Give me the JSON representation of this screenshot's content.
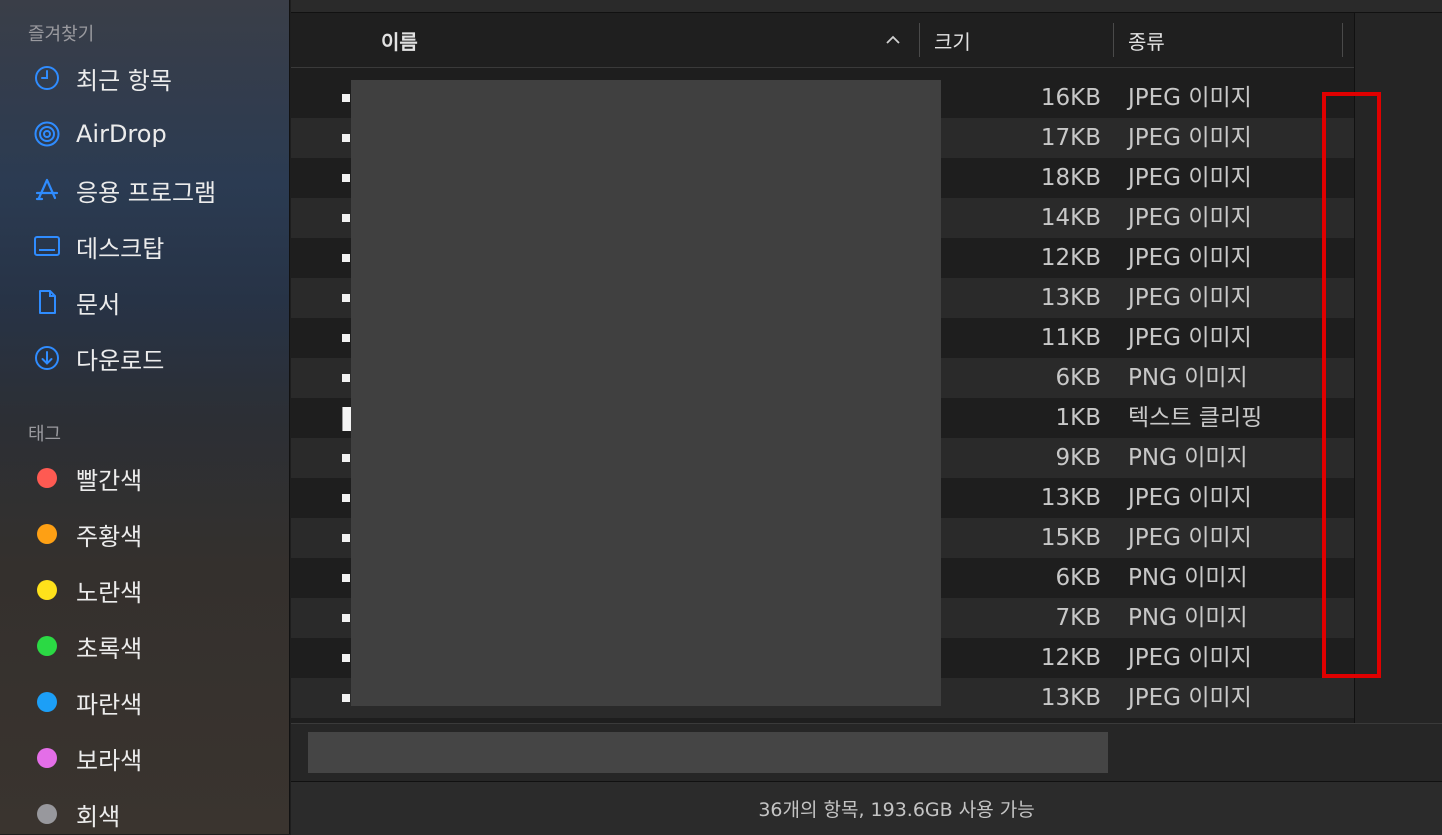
{
  "sidebar": {
    "favorites_title": "즐겨찾기",
    "favorites": [
      {
        "label": "최근 항목",
        "icon": "clock-icon"
      },
      {
        "label": "AirDrop",
        "icon": "airdrop-icon"
      },
      {
        "label": "응용 프로그램",
        "icon": "applications-icon"
      },
      {
        "label": "데스크탑",
        "icon": "desktop-icon"
      },
      {
        "label": "문서",
        "icon": "document-icon"
      },
      {
        "label": "다운로드",
        "icon": "download-icon"
      }
    ],
    "tags_title": "태그",
    "tags": [
      {
        "label": "빨간색",
        "color": "#fe5a52"
      },
      {
        "label": "주황색",
        "color": "#fea014"
      },
      {
        "label": "노란색",
        "color": "#fee11b"
      },
      {
        "label": "초록색",
        "color": "#2bd944"
      },
      {
        "label": "파란색",
        "color": "#1c9ff7"
      },
      {
        "label": "보라색",
        "color": "#e46ee8"
      },
      {
        "label": "회색",
        "color": "#98989d"
      }
    ]
  },
  "columns": {
    "name": "이름",
    "size": "크기",
    "kind": "종류"
  },
  "files": [
    {
      "size": "16KB",
      "kind": "JPEG 이미지"
    },
    {
      "size": "17KB",
      "kind": "JPEG 이미지"
    },
    {
      "size": "18KB",
      "kind": "JPEG 이미지"
    },
    {
      "size": "14KB",
      "kind": "JPEG 이미지"
    },
    {
      "size": "12KB",
      "kind": "JPEG 이미지"
    },
    {
      "size": "13KB",
      "kind": "JPEG 이미지"
    },
    {
      "size": "11KB",
      "kind": "JPEG 이미지"
    },
    {
      "size": "6KB",
      "kind": "PNG 이미지"
    },
    {
      "size": "1KB",
      "kind": "텍스트 클리핑"
    },
    {
      "size": "9KB",
      "kind": "PNG 이미지"
    },
    {
      "size": "13KB",
      "kind": "JPEG 이미지"
    },
    {
      "size": "15KB",
      "kind": "JPEG 이미지"
    },
    {
      "size": "6KB",
      "kind": "PNG 이미지"
    },
    {
      "size": "7KB",
      "kind": "PNG 이미지"
    },
    {
      "size": "12KB",
      "kind": "JPEG 이미지"
    },
    {
      "size": "13KB",
      "kind": "JPEG 이미지"
    }
  ],
  "status": {
    "text": "36개의 항목, 193.6GB 사용 가능"
  },
  "colors": {
    "accent": "#2f8cff",
    "highlight": "#e00000"
  }
}
